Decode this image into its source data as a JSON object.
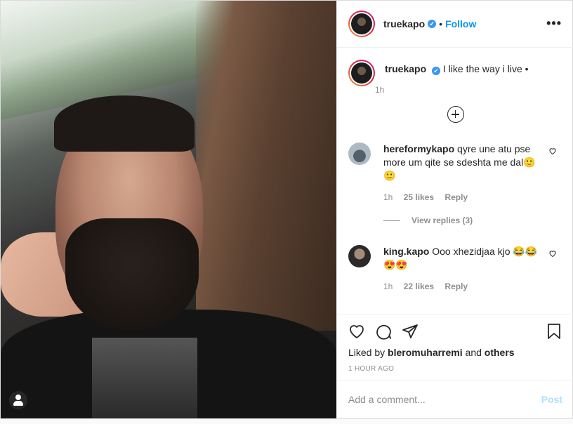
{
  "header": {
    "username": "truekapo",
    "verified_glyph": "✔",
    "separator": "•",
    "follow_label": "Follow",
    "more_glyph": "•••"
  },
  "caption": {
    "username": "truekapo",
    "text": "I like the way i live •",
    "time": "1h"
  },
  "comments": [
    {
      "username": "hereformykapo",
      "text": "qyre une atu pse more um qite se sdeshta me dal🙂 🙂",
      "time": "1h",
      "likes": "25 likes",
      "reply_label": "Reply",
      "view_replies": "View replies (3)"
    },
    {
      "username": "king.kapo",
      "text": "Ooo xhezidjaa kjo 😂😂 😍😍",
      "time": "1h",
      "likes": "22 likes",
      "reply_label": "Reply"
    }
  ],
  "likes": {
    "prefix": "Liked by",
    "user": "bleromuharremi",
    "joiner": "and",
    "others": "others"
  },
  "timestamp": "1 HOUR AGO",
  "add_comment": {
    "placeholder": "Add a comment...",
    "post_label": "Post"
  },
  "colors": {
    "link": "#0095f6",
    "post_disabled": "#b2dffc",
    "muted": "#8e8e8e",
    "verified": "#3897f0"
  },
  "icons": [
    "heart-icon",
    "comment-icon",
    "share-icon",
    "bookmark-icon",
    "plus-circle-icon",
    "user-tag-icon",
    "more-icon"
  ]
}
